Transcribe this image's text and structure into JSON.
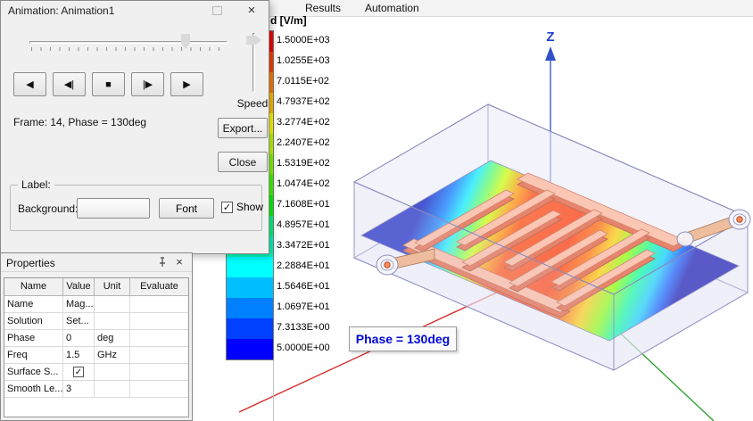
{
  "menubar": {
    "items": [
      "Results",
      "Automation"
    ]
  },
  "animation_dialog": {
    "title": "Animation: Animation1",
    "close_x": "×",
    "frame_info": "Frame: 14, Phase = 130deg",
    "speed_label": "Speed",
    "export_button": "Export...",
    "close_button": "Close",
    "playback_buttons": [
      {
        "name": "prev",
        "glyph": "◀"
      },
      {
        "name": "step-back",
        "glyph": "◀|"
      },
      {
        "name": "stop",
        "glyph": "■"
      },
      {
        "name": "step-forward",
        "glyph": "|▶"
      },
      {
        "name": "play",
        "glyph": "▶"
      }
    ],
    "label_group": {
      "title": "Label:",
      "background_label": "Background:",
      "font_button": "Font",
      "show_label": "Show",
      "show_checked": true
    }
  },
  "properties_panel": {
    "title": "Properties",
    "close_x": "×",
    "columns": [
      "Name",
      "Value",
      "Unit",
      "Evaluate"
    ],
    "rows": [
      {
        "name": "Name",
        "value": "Mag...",
        "unit": "",
        "evaluate": "",
        "type": "text"
      },
      {
        "name": "Solution",
        "value": "Set...",
        "unit": "",
        "evaluate": "",
        "type": "text"
      },
      {
        "name": "Phase",
        "value": "0",
        "unit": "deg",
        "evaluate": "",
        "type": "text"
      },
      {
        "name": "Freq",
        "value": "1.5",
        "unit": "GHz",
        "evaluate": "",
        "type": "text"
      },
      {
        "name": "Surface S...",
        "value": "",
        "unit": "",
        "evaluate": "",
        "type": "checkbox",
        "checked": true
      },
      {
        "name": "Smooth Le...",
        "value": "3",
        "unit": "",
        "evaluate": "",
        "type": "text"
      }
    ]
  },
  "legend": {
    "title": "d [V/m]",
    "entries": [
      {
        "value": "1.5000E+03",
        "color": "#ff0000"
      },
      {
        "value": "1.0255E+03",
        "color": "#ff4000"
      },
      {
        "value": "7.0115E+02",
        "color": "#ff8000"
      },
      {
        "value": "4.7937E+02",
        "color": "#ffbf00"
      },
      {
        "value": "3.2774E+02",
        "color": "#ffff00"
      },
      {
        "value": "2.2407E+02",
        "color": "#bfff00"
      },
      {
        "value": "1.5319E+02",
        "color": "#80ff00"
      },
      {
        "value": "1.0474E+02",
        "color": "#40ff00"
      },
      {
        "value": "7.1608E+01",
        "color": "#00ff00"
      },
      {
        "value": "4.8957E+01",
        "color": "#00ff80"
      },
      {
        "value": "3.3472E+01",
        "color": "#00ffbf"
      },
      {
        "value": "2.2884E+01",
        "color": "#00ffff"
      },
      {
        "value": "1.5646E+01",
        "color": "#00bfff"
      },
      {
        "value": "1.0697E+01",
        "color": "#0080ff"
      },
      {
        "value": "7.3133E+00",
        "color": "#0040ff"
      },
      {
        "value": "5.0000E+00",
        "color": "#0000ff"
      }
    ]
  },
  "scene": {
    "z_axis_label": "Z",
    "phase_annotation": "Phase = 130deg",
    "axis_colors": {
      "x": "#d42222",
      "y": "#22a022",
      "z": "#3050cc"
    }
  }
}
